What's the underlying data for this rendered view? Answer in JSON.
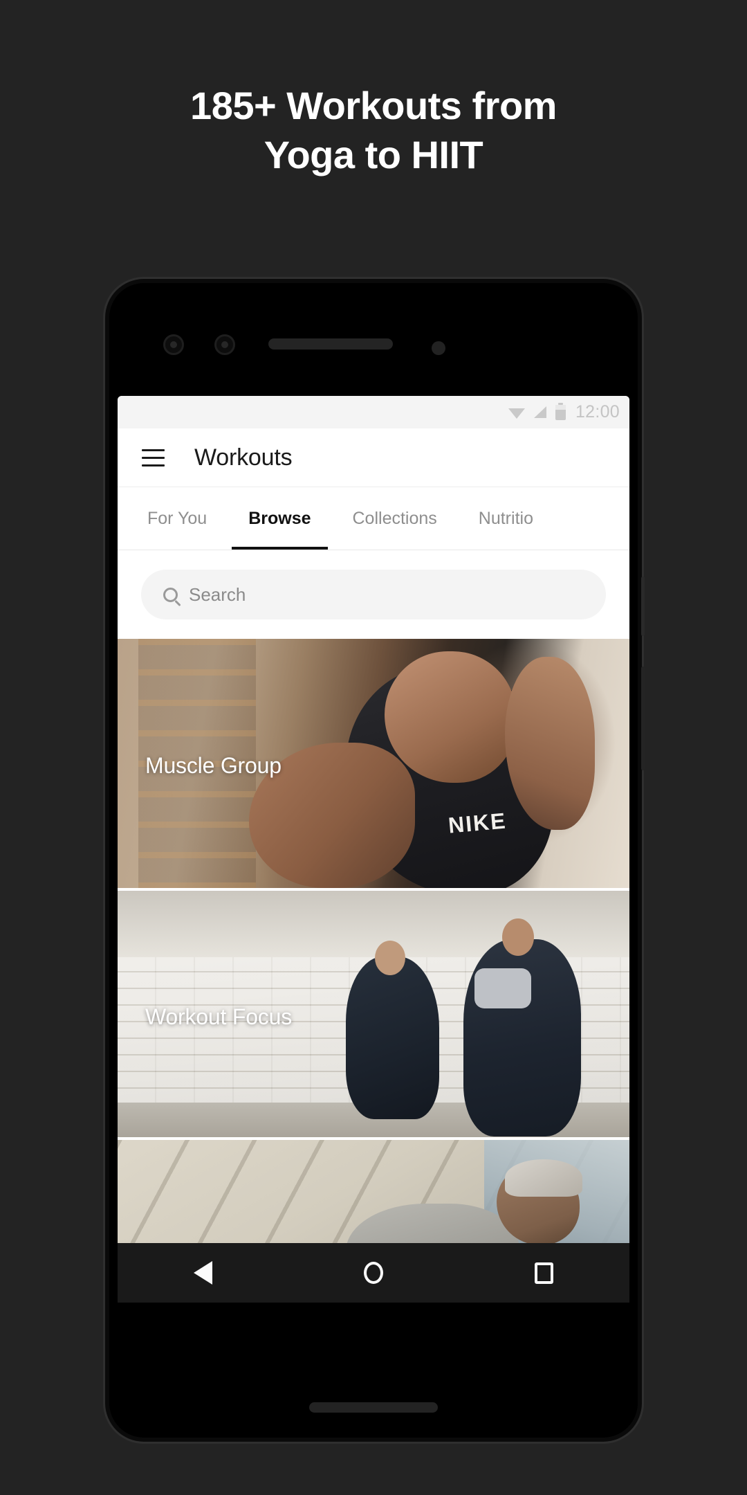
{
  "promo": {
    "headline_line1": "185+ Workouts from",
    "headline_line2": "Yoga to HIIT",
    "background_color": "#232323",
    "text_color": "#ffffff"
  },
  "device": {
    "frame_color": "#0a0a0a",
    "hardware": {
      "sensor_left": "camera-sensor",
      "sensor_right": "proximity-sensor",
      "earpiece": "earpiece-speaker",
      "front_camera": "front-camera-dot",
      "bottom_speaker": "bottom-speaker-grille"
    }
  },
  "statusbar": {
    "wifi_icon": "wifi-icon",
    "signal_icon": "cell-signal-icon",
    "battery_icon": "battery-icon",
    "time": "12:00",
    "background_color": "#f4f4f4"
  },
  "appbar": {
    "menu_icon": "hamburger-menu-icon",
    "title": "Workouts"
  },
  "tabs": {
    "active_index": 1,
    "items": [
      {
        "label": "For You"
      },
      {
        "label": "Browse"
      },
      {
        "label": "Collections"
      },
      {
        "label": "Nutritio"
      }
    ],
    "indicator_color": "#111111"
  },
  "search": {
    "icon": "search-icon",
    "placeholder": "Search",
    "value": "",
    "background_color": "#f4f4f4"
  },
  "cards": [
    {
      "label": "Muscle Group",
      "photo_alt": "woman-in-black-nike-tank-stretching",
      "brand_mark": "NIKE"
    },
    {
      "label": "Workout Focus",
      "photo_alt": "two-people-lunging-in-white-brick-studio"
    },
    {
      "label": "",
      "photo_alt": "man-in-grey-tee-resting-near-window"
    }
  ],
  "navbar": {
    "back_label": "Back",
    "home_label": "Home",
    "recents_label": "Recents",
    "background_color": "#1a1a1a"
  }
}
